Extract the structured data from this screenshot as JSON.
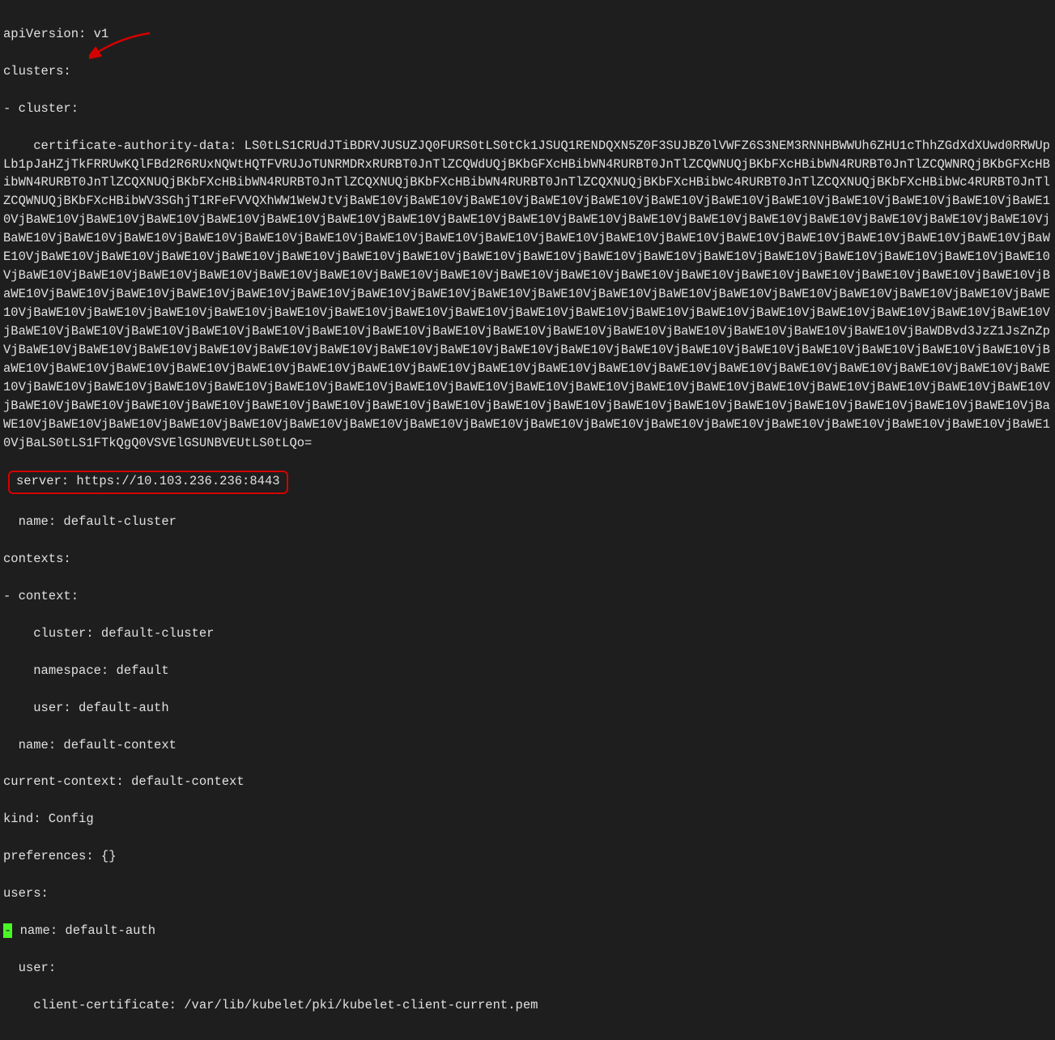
{
  "yaml": {
    "apiVersion": "apiVersion: v1",
    "clusters": "clusters:",
    "cluster_dash": "- cluster:",
    "cert_key": "    certificate-authority-data: ",
    "cert_data": "LS0tLS1CRUdJTiBDRVJUSUZJQ0FURS0tLS0tCk1JSUQ1RENDQXN5Z0F3SUJBZ0lVWFZ6S3NEM3RNNHBWWUh6ZHU1cThhZGdXdXUwd0RRWUpLb1pJaHZjTkFRRUwKQlFBd2R6RUxNQWtHQTFVRUJoTUNRMDRxRURBT0JnTlZCQWdUQjBKbGFXcHBibWN4RURBT0JnTlZCQWNUQjBKbFXcHBibWN4RURBT0JnTlZCQWNRQjBKbGFXcHBibWN4RURBT0JnTlZCQXNUQjBKbFXcHBibWN4RURBT0JnTlZCQXNUQjBKbFXcHBibWN4RURBT0JnTlZCQXNUQjBKbFXcHBibWc4RURBT0JnTlZCQXNUQjBKbFXcHBibWc4RURBT0JnTlZCQWNUQjBKbFXcHBibWV3SGhjT1RFeFVVQXhWW1WeWJtVjBaWE10VjBaWE10VjBaWE10VjBaWE10VjBaWE10VjBaWE10VjBaWE10VjBaWE10VjBaWE10VjBaWE10VjBaWE10VjBaWE10VjBaWE10VjBaWE10VjBaWE10VjBaWE10VjBaWE10VjBaWE10VjBaWE10VjBaWE10VjBaWE10VjBaWE10VjBaWE10VjBaWE10VjBaWE10VjBaWE10VjBaWE10VjBaWE10VjBaWE10VjBaWE10VjBaWE10VjBaWE10VjBaWE10VjBaWE10VjBaWE10VjBaWE10VjBaWE10VjBaWE10VjBaWE10VjBaWE10VjBaWE10VjBaWE10VjBaWE10VjBaWE10VjBaWE10VjBaWE10VjBaWE10VjBaWE10VjBaWE10VjBaWE10VjBaWE10VjBaWE10VjBaWE10VjBaWE10VjBaWE10VjBaWE10VjBaWE10VjBaWE10VjBaWE10VjBaWE10VjBaWE10VjBaWE10VjBaWE10VjBaWE10VjBaWE10VjBaWE10VjBaWE10VjBaWE10VjBaWE10VjBaWE10VjBaWE10VjBaWE10VjBaWE10VjBaWE10VjBaWE10VjBaWE10VjBaWE10VjBaWE10VjBaWE10VjBaWE10VjBaWE10VjBaWE10VjBaWE10VjBaWE10VjBaWE10VjBaWE10VjBaWE10VjBaWE10VjBaWE10VjBaWE10VjBaWE10VjBaWE10VjBaWE10VjBaWE10VjBaWE10VjBaWE10VjBaWE10VjBaWE10VjBaWE10VjBaWE10VjBaWE10VjBaWE10VjBaWE10VjBaWE10VjBaWE10VjBaWE10VjBaWE10VjBaWE10VjBaWE10VjBaWE10VjBaWE10VjBaWE10VjBaWE10VjBaWE10VjBaWE10VjBaWE10VjBaWE10VjBaWE10VjBaWE10VjBaWE10VjBaWE10VjBaWE10VjBaWE10VjBaWE10VjBaWE10VjBaWE10VjBaWE10VjBaWE10VjBaWE10VjBaWE10VjBaWE10VjBaWDBvd3JzZ1JsZnZpVjBaWE10VjBaWE10VjBaWE10VjBaWE10VjBaWE10VjBaWE10VjBaWE10VjBaWE10VjBaWE10VjBaWE10VjBaWE10VjBaWE10VjBaWE10VjBaWE10VjBaWE10VjBaWE10VjBaWE10VjBaWE10VjBaWE10VjBaWE10VjBaWE10VjBaWE10VjBaWE10VjBaWE10VjBaWE10VjBaWE10VjBaWE10VjBaWE10VjBaWE10VjBaWE10VjBaWE10VjBaWE10VjBaWE10VjBaWE10VjBaWE10VjBaWE10VjBaWE10VjBaWE10VjBaWE10VjBaWE10VjBaWE10VjBaWE10VjBaWE10VjBaWE10VjBaWE10VjBaWE10VjBaWE10VjBaWE10VjBaWE10VjBaWE10VjBaWE10VjBaWE10VjBaWE10VjBaWE10VjBaWE10VjBaWE10VjBaWE10VjBaWE10VjBaWE10VjBaWE10VjBaWE10VjBaWE10VjBaWE10VjBaWE10VjBaWE10VjBaWE10VjBaWE10VjBaWE10VjBaWE10VjBaWE10VjBaWE10VjBaWE10VjBaWE10VjBaWE10VjBaWE10VjBaWE10VjBaWE10VjBaWE10VjBaWE10VjBaWE10VjBaWE10VjBaWE10VjBaWE10VjBaWE10VjBaWE10VjBaWE10VjBaWE10VjBaLS0tLS1FTkQgQ0VSVElGSUNBVEUtLS0tLQo=",
    "server": "server: https://10.103.236.236:8443",
    "name_cluster": "  name: default-cluster",
    "contexts": "contexts:",
    "context_dash": "- context:",
    "ctx_cluster": "    cluster: default-cluster",
    "ctx_namespace": "    namespace: default",
    "ctx_user": "    user: default-auth",
    "ctx_name": "  name: default-context",
    "current_context": "current-context: default-context",
    "kind": "kind: Config",
    "preferences": "preferences: {}",
    "users": "users:",
    "users_name_prefix": "-",
    "users_name": " name: default-auth",
    "user": "  user:",
    "client_cert": "    client-certificate: /var/lib/kubelet/pki/kubelet-client-current.pem"
  }
}
